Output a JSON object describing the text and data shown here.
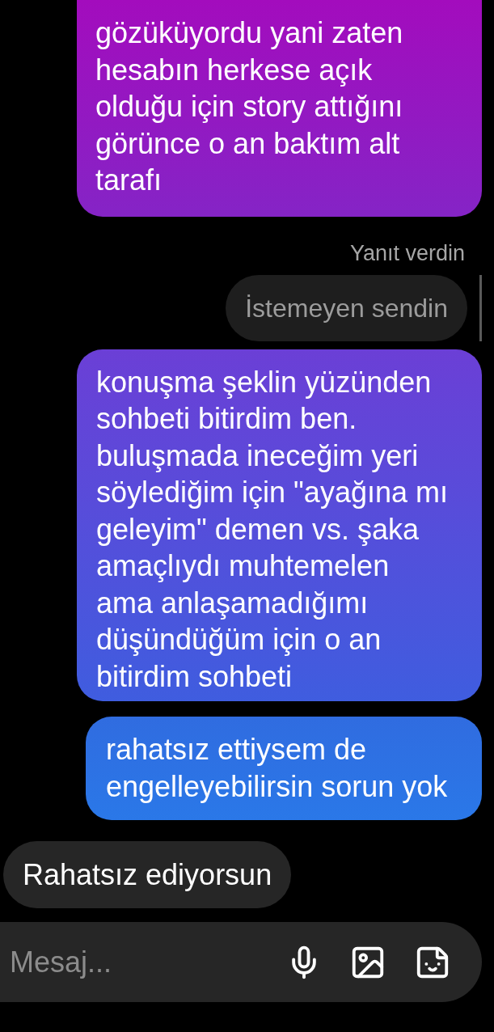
{
  "messages": [
    {
      "kind": "sent",
      "text": "gözüküyordu yani zaten hesabın herkese açık olduğu için story attığını görünce o an baktım alt tarafı"
    },
    {
      "kind": "reply_label",
      "text": "Yanıt verdin"
    },
    {
      "kind": "reply_quote",
      "text": "İstemeyen sendin"
    },
    {
      "kind": "sent",
      "text": "konuşma şeklin yüzünden sohbeti bitirdim ben. buluşmada ineceğim yeri söylediğim için \"ayağına mı geleyim\" demen vs. şaka amaçlıydı muhtemelen ama anlaşamadığımı düşündüğüm için o an bitirdim sohbeti"
    },
    {
      "kind": "sent",
      "text": "rahatsız ettiysem de engelleyebilirsin sorun yok"
    },
    {
      "kind": "received",
      "text": "Rahatsız ediyorsun"
    }
  ],
  "composer": {
    "placeholder": "Mesaj..."
  }
}
